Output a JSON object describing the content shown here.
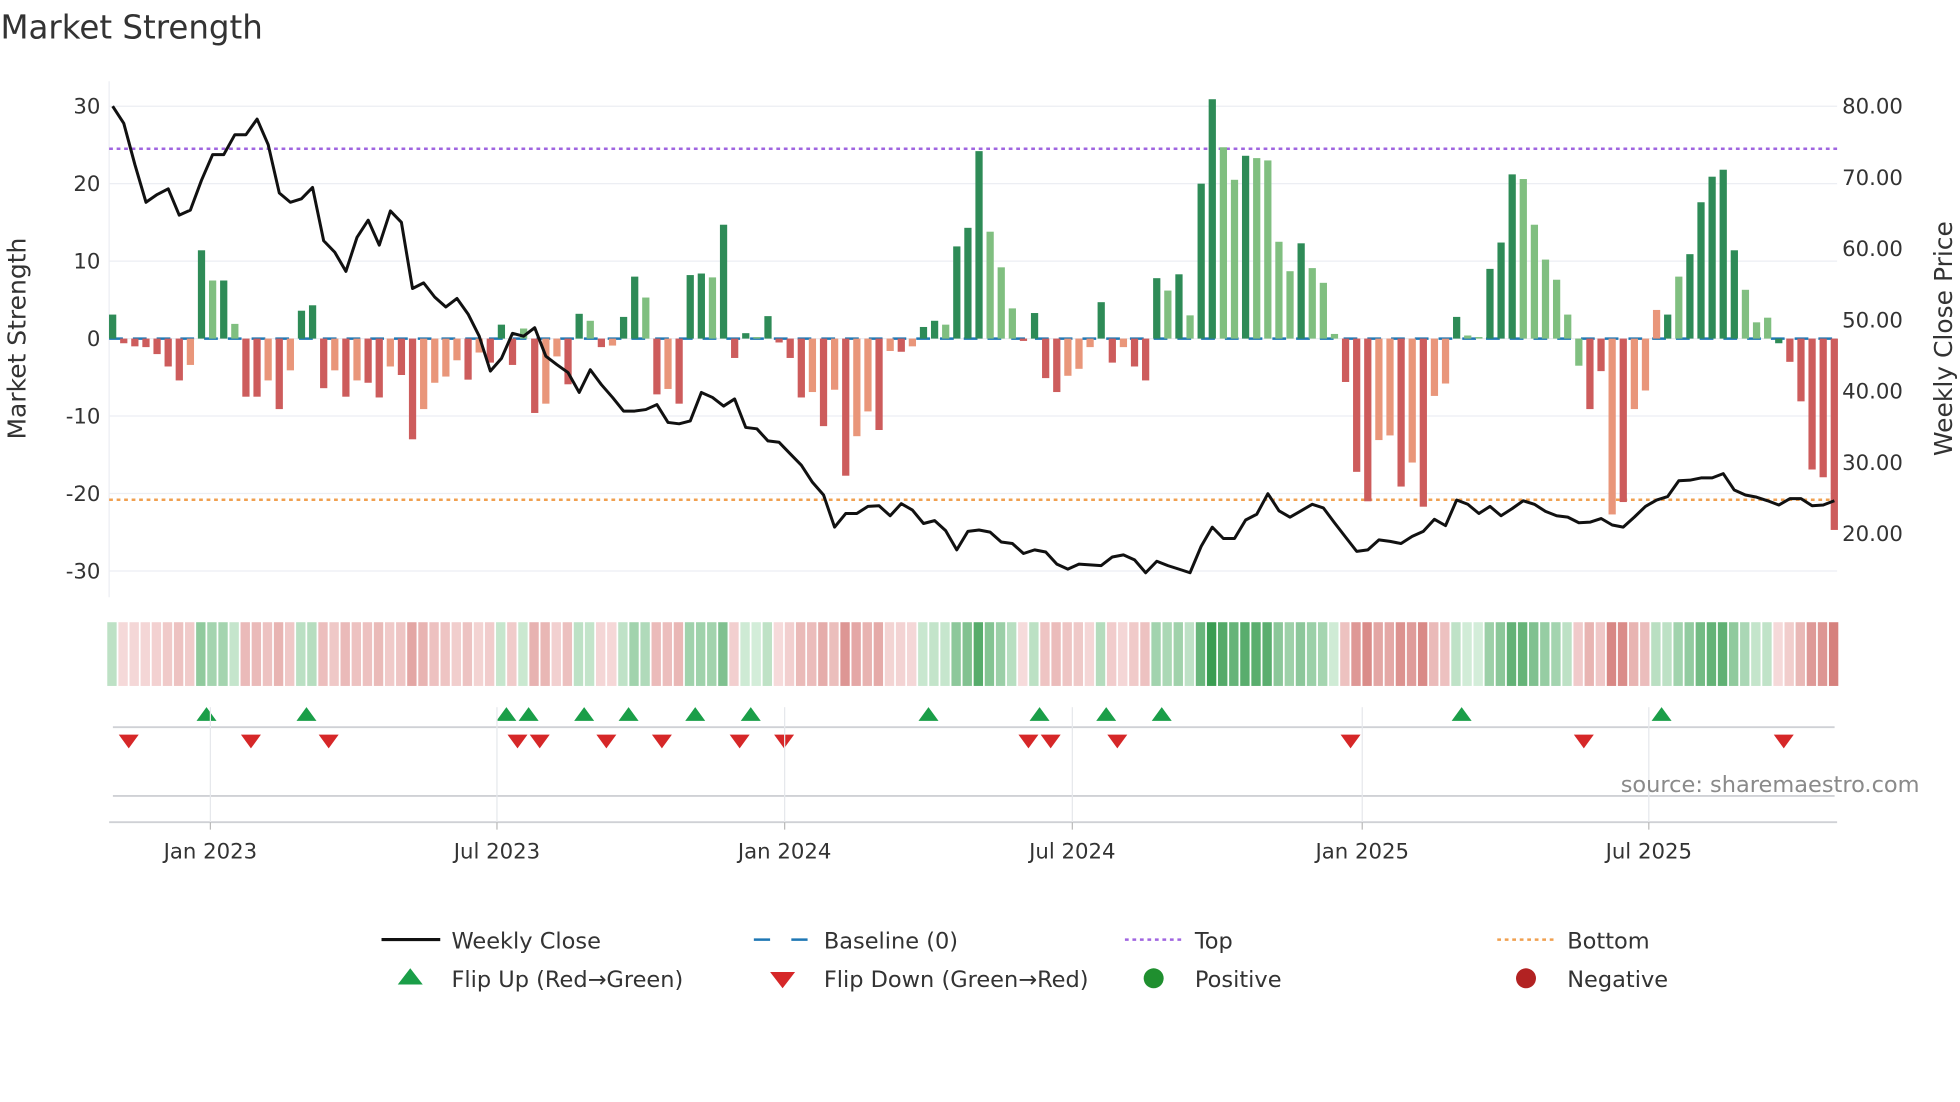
{
  "chart_data": {
    "type": "bar",
    "title": "Market Strength",
    "ylabel": "Market Strength",
    "ylabel_right": "Weekly Close Price",
    "ylim": [
      -33,
      33
    ],
    "ylim_right": [
      14,
      82
    ],
    "yticks": [
      30,
      20,
      10,
      0,
      -10,
      -20,
      -30
    ],
    "yticks_right": [
      "80.00",
      "70.00",
      "60.00",
      "50.00",
      "40.00",
      "30.00",
      "20.00"
    ],
    "yticks_right_values": [
      80,
      70,
      60,
      50,
      40,
      30,
      20
    ],
    "x_unit": "week index",
    "x_ticks": [
      {
        "label": "Jan 2023",
        "week": 8.8
      },
      {
        "label": "Jul 2023",
        "week": 34.6
      },
      {
        "label": "Jan 2024",
        "week": 60.5
      },
      {
        "label": "Jul 2024",
        "week": 86.4
      },
      {
        "label": "Jan 2025",
        "week": 112.5
      },
      {
        "label": "Jul 2025",
        "week": 138.3
      }
    ],
    "top_line": 24.5,
    "bottom_line": -20.8,
    "baseline": 0,
    "strength": [
      3.1,
      -0.6,
      -1.0,
      -1.1,
      -2.0,
      -3.6,
      -5.4,
      -3.4,
      11.4,
      7.5,
      7.5,
      1.9,
      -7.5,
      -7.5,
      -5.4,
      -9.1,
      -4.1,
      3.6,
      4.3,
      -6.4,
      -4.1,
      -7.5,
      -5.4,
      -5.7,
      -7.6,
      -3.6,
      -4.7,
      -13.0,
      -9.1,
      -5.7,
      -4.9,
      -2.8,
      -5.3,
      -1.8,
      -3.1,
      1.8,
      -3.4,
      1.3,
      -9.6,
      -8.4,
      -2.3,
      -5.9,
      3.2,
      2.3,
      -1.1,
      -0.9,
      2.8,
      8.0,
      5.3,
      -7.2,
      -6.5,
      -8.4,
      8.2,
      8.4,
      7.9,
      14.7,
      -2.5,
      0.7,
      0.2,
      2.9,
      -0.5,
      -2.5,
      -7.6,
      -6.9,
      -11.3,
      -6.6,
      -17.7,
      -12.6,
      -9.4,
      -11.8,
      -1.6,
      -1.7,
      -1.0,
      1.5,
      2.3,
      1.8,
      11.9,
      14.3,
      24.2,
      13.8,
      9.2,
      3.9,
      -0.3,
      3.3,
      -5.1,
      -6.9,
      -4.8,
      -3.9,
      -1.1,
      4.7,
      -3.1,
      -1.1,
      -3.6,
      -5.4,
      7.8,
      6.2,
      8.3,
      3.0,
      20.0,
      30.9,
      24.7,
      20.5,
      23.6,
      23.3,
      23.0,
      12.5,
      8.7,
      12.3,
      9.1,
      7.2,
      0.6,
      -5.6,
      -17.2,
      -21.0,
      -13.1,
      -12.5,
      -19.1,
      -16.0,
      -21.7,
      -7.4,
      -5.8,
      2.8,
      0.4,
      0.2,
      9.0,
      12.4,
      21.2,
      20.6,
      14.7,
      10.2,
      7.6,
      3.1,
      -3.5,
      -9.1,
      -4.2,
      -22.7,
      -21.1,
      -9.1,
      -6.7,
      3.7,
      3.1,
      8.0,
      10.9,
      17.6,
      20.9,
      21.8,
      11.4,
      6.3,
      2.1,
      2.7,
      -0.6,
      -3.0,
      -8.1,
      -16.9,
      -17.9,
      -24.7
    ],
    "bar_shades": "GRRRRRRrGgGgRRrRrGGRrRrRRrRRrrrrRrRGRgRrrRGgRrGGgRrRGGgGRGgGRRRrRrRrrRrRrGGgGGGgggRGRRrrrGRrRRGgGgGGggGggggGgggRRRrrRrRrrGggGGGggggggRRrRrrrGgGGGGGgggGRRRRRR",
    "weekly_close": [
      80.0,
      77.6,
      71.8,
      66.5,
      67.6,
      68.4,
      64.7,
      65.4,
      69.6,
      73.2,
      73.2,
      76.0,
      76.0,
      78.2,
      74.6,
      67.8,
      66.5,
      67.0,
      68.6,
      61.1,
      59.5,
      56.8,
      61.6,
      64.0,
      60.5,
      65.3,
      63.7,
      54.4,
      55.2,
      53.2,
      51.8,
      53.0,
      50.8,
      47.7,
      42.8,
      44.6,
      48.1,
      47.7,
      48.9,
      44.9,
      43.7,
      42.6,
      39.8,
      43.0,
      40.9,
      39.1,
      37.2,
      37.2,
      37.4,
      38.1,
      35.6,
      35.4,
      35.8,
      39.8,
      39.1,
      37.9,
      38.9,
      34.9,
      34.7,
      33.0,
      32.8,
      31.2,
      29.6,
      27.2,
      25.4,
      20.9,
      22.8,
      22.8,
      23.8,
      23.9,
      22.5,
      24.2,
      23.3,
      21.4,
      21.8,
      20.4,
      17.7,
      20.3,
      20.5,
      20.2,
      18.8,
      18.6,
      17.2,
      17.7,
      17.4,
      15.7,
      15.0,
      15.7,
      15.6,
      15.5,
      16.7,
      17.0,
      16.3,
      14.5,
      16.1,
      15.5,
      15.0,
      14.5,
      18.2,
      20.9,
      19.3,
      19.3,
      21.9,
      22.7,
      25.6,
      23.2,
      22.3,
      23.2,
      24.1,
      23.6,
      21.5,
      19.5,
      17.5,
      17.7,
      19.1,
      18.9,
      18.6,
      19.6,
      20.3,
      22.0,
      21.1,
      24.7,
      24.1,
      22.8,
      23.8,
      22.5,
      23.5,
      24.6,
      24.1,
      23.1,
      22.5,
      22.3,
      21.5,
      21.6,
      22.1,
      21.2,
      20.9,
      22.3,
      23.8,
      24.7,
      25.2,
      27.4,
      27.5,
      27.8,
      27.8,
      28.4,
      26.1,
      25.4,
      25.1,
      24.6,
      24.0,
      24.9,
      24.9,
      23.9,
      24.0,
      24.6
    ],
    "flip_up_weeks": [
      8,
      17,
      35,
      37,
      42,
      46,
      52,
      57,
      73,
      83,
      89,
      94,
      121,
      139
    ],
    "flip_down_weeks": [
      1,
      12,
      19,
      36,
      38,
      44,
      49,
      56,
      60,
      82,
      84,
      90,
      111,
      132,
      150
    ],
    "legend_position": "bottom",
    "legend": [
      {
        "label": "Weekly Close",
        "kind": "line"
      },
      {
        "label": "Baseline (0)",
        "kind": "dashed"
      },
      {
        "label": "Top",
        "kind": "dotted-purple"
      },
      {
        "label": "Bottom",
        "kind": "dotted-orange"
      },
      {
        "label": "Flip Up (Red→Green)",
        "kind": "triangle-up"
      },
      {
        "label": "Flip Down (Green→Red)",
        "kind": "triangle-down"
      },
      {
        "label": "Positive",
        "kind": "dot-green"
      },
      {
        "label": "Negative",
        "kind": "dot-red"
      }
    ],
    "grid": true
  },
  "source": "source: sharemaestro.com",
  "colors": {
    "pos_strong": "#2e8b57",
    "pos_weak": "#80bf80",
    "neg_strong": "#cd5c5c",
    "neg_weak": "#e9967a",
    "baseline": "#1f77b4",
    "top": "#a066e0",
    "bottom": "#f0a050",
    "price": "#111111",
    "flip_up": "#1a9e48",
    "flip_down": "#d62728",
    "positive_dot": "#1f8f2f",
    "negative_dot": "#b22222"
  }
}
